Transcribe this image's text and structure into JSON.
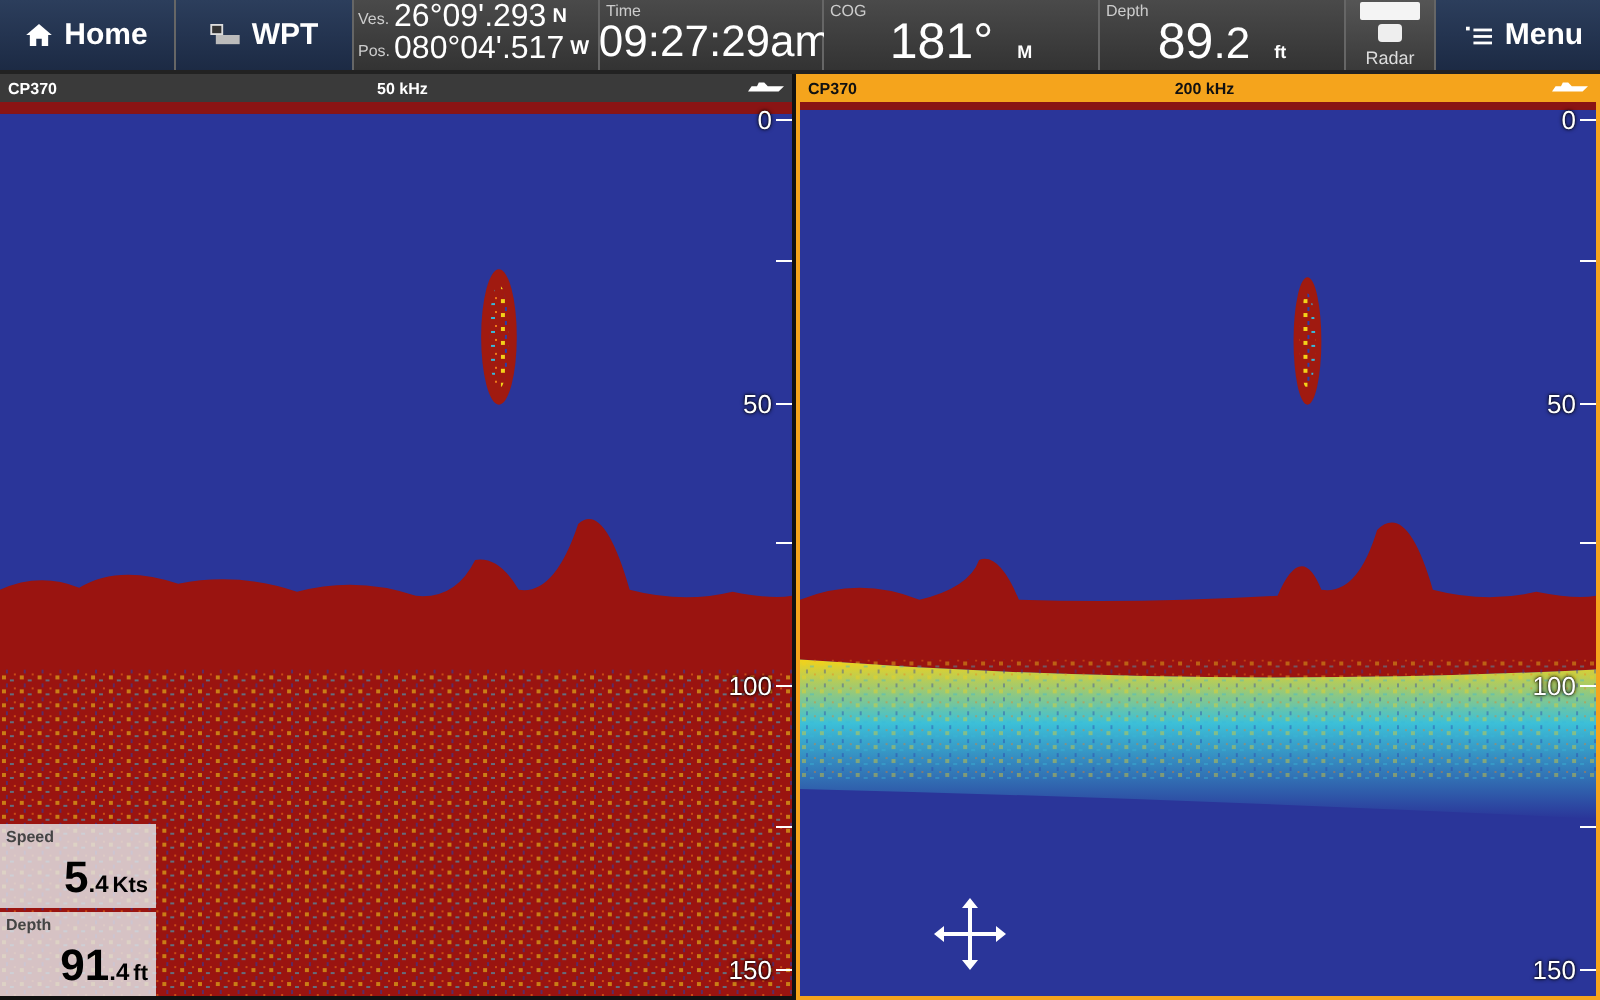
{
  "top_bar": {
    "home_button": "Home",
    "wpt_button": "WPT",
    "position": {
      "label_1": "Ves.",
      "label_2": "Pos.",
      "lat": "26°09'.293",
      "lat_hemi": "N",
      "lon": "080°04'.517",
      "lon_hemi": "W"
    },
    "time": {
      "label": "Time",
      "value": "09:27:29am"
    },
    "cog": {
      "label": "COG",
      "value": "181°",
      "unit": "M"
    },
    "depth": {
      "label": "Depth",
      "value": "89",
      "decimal": ".2",
      "unit": "ft"
    },
    "radar_button": "Radar",
    "menu_button": "Menu"
  },
  "panes": [
    {
      "transducer": "CP370",
      "frequency": "50 kHz",
      "selected": false,
      "scale": [
        "0",
        "50",
        "100",
        "150"
      ],
      "overlays": [
        {
          "label": "Speed",
          "value": "5",
          "decimal": ".4",
          "unit": "Kts"
        },
        {
          "label": "Depth",
          "value": "91",
          "decimal": ".4",
          "unit": "ft"
        }
      ]
    },
    {
      "transducer": "CP370",
      "frequency": "200 kHz",
      "selected": true,
      "scale": [
        "0",
        "50",
        "100",
        "150"
      ]
    }
  ]
}
